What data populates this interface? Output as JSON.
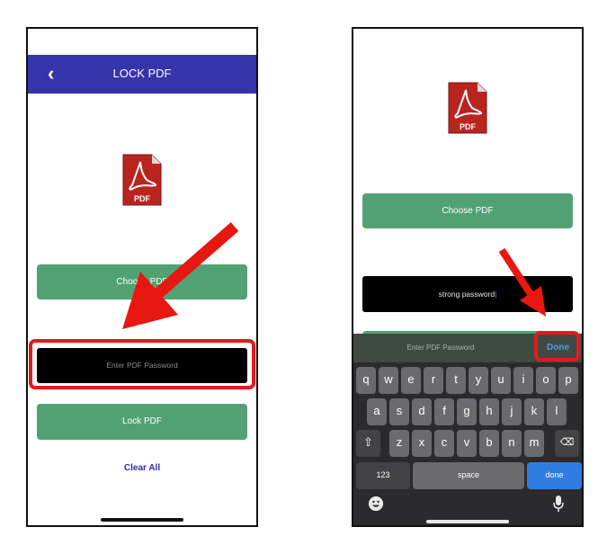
{
  "left_phone": {
    "header_title": "LOCK PDF",
    "back_icon": "chevron-left-icon",
    "pdf_badge": "PDF",
    "choose_label": "Choose PDF",
    "password_placeholder": "Enter PDF Password",
    "lock_label": "Lock PDF",
    "clear_label": "Clear All"
  },
  "right_phone": {
    "pdf_badge": "PDF",
    "choose_label": "Choose PDF",
    "password_value": "strong password",
    "keyboard_toolbar": {
      "placeholder": "Enter PDF Password",
      "done_label": "Done"
    },
    "keyboard": {
      "row1": [
        "q",
        "w",
        "e",
        "r",
        "t",
        "y",
        "u",
        "i",
        "o",
        "p"
      ],
      "row2": [
        "a",
        "s",
        "d",
        "f",
        "g",
        "h",
        "j",
        "k",
        "l"
      ],
      "row3": [
        "z",
        "x",
        "c",
        "v",
        "b",
        "n",
        "m"
      ],
      "shift_icon": "shift-icon",
      "backspace_icon": "backspace-icon",
      "numbers_label": "123",
      "space_label": "space",
      "done_label": "done",
      "emoji_icon": "emoji-icon",
      "mic_icon": "microphone-icon"
    }
  },
  "colors": {
    "header": "#3534a9",
    "button_green": "#52a173",
    "highlight_red": "#e21b1b",
    "link_blue": "#2d2da6"
  }
}
